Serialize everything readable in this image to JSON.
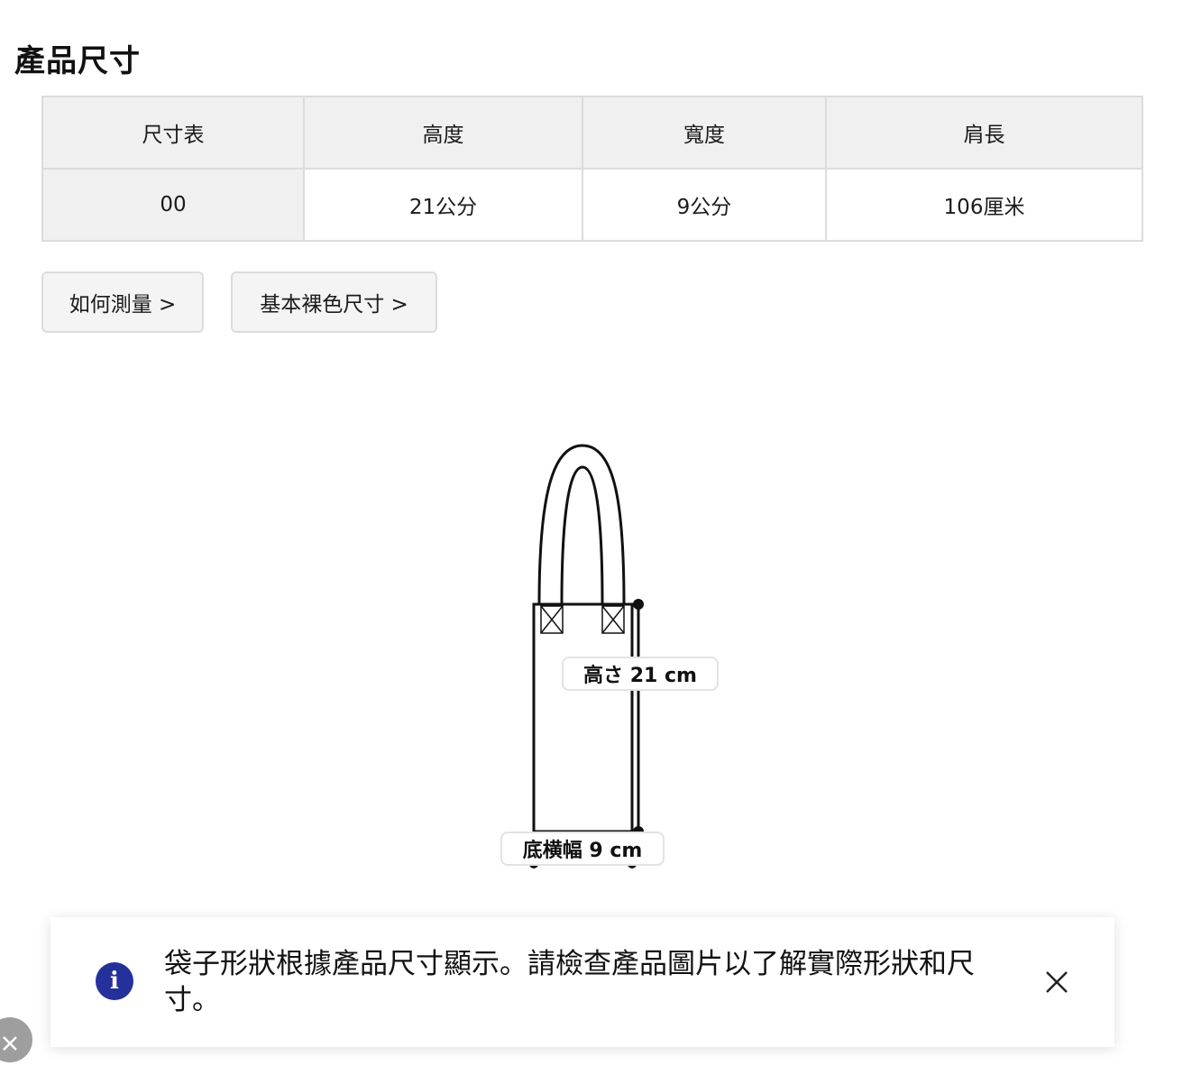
{
  "section": {
    "title": "產品尺寸"
  },
  "size_table": {
    "headers": [
      "尺寸表",
      "高度",
      "寬度",
      "肩長"
    ],
    "rows": [
      [
        "00",
        "21公分",
        "9公分",
        "106厘米"
      ]
    ]
  },
  "buttons": {
    "how_to_measure": "如何測量 >",
    "nude_size": "基本裸色尺寸 >"
  },
  "diagram": {
    "height_label": "高さ 21 cm",
    "width_label": "底横幅 9 cm"
  },
  "notice": {
    "text": "袋子形狀根據產品尺寸顯示。請檢查產品圖片以了解實際形狀和尺寸。",
    "info_icon_glyph": "i",
    "icon_color": "#25319a"
  }
}
